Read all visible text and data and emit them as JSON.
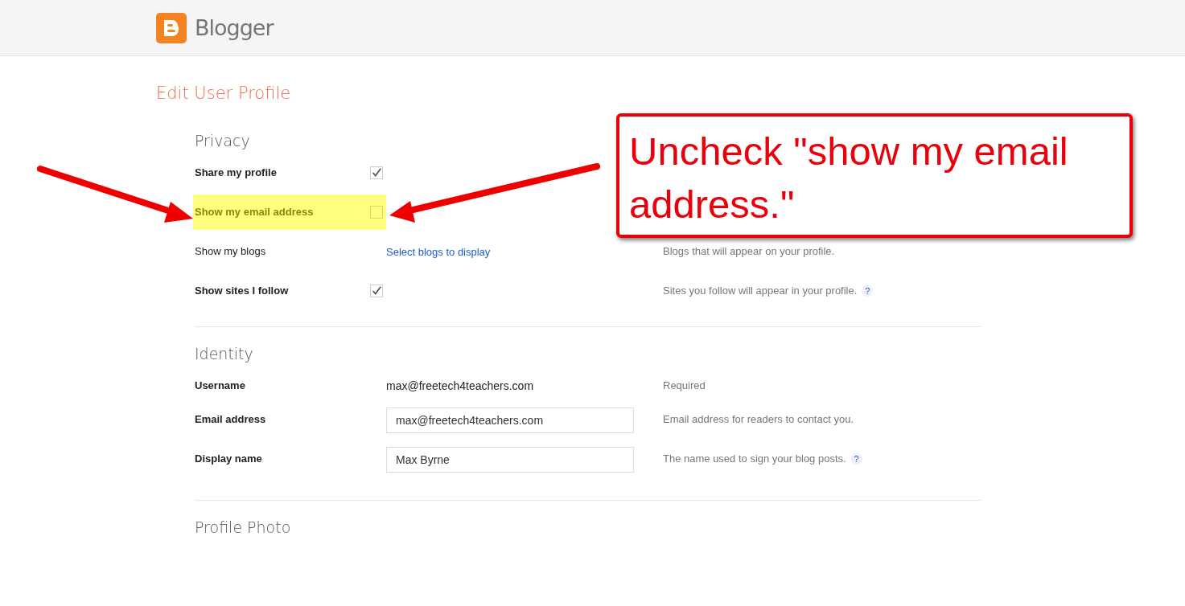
{
  "header": {
    "brand": "Blogger"
  },
  "page_title": "Edit User Profile",
  "sections": [
    {
      "title": "Privacy",
      "rows": [
        {
          "kind": "checkbox",
          "label": "Share my profile",
          "checked": true,
          "highlighted": false
        },
        {
          "kind": "checkbox",
          "label": "Show my email address",
          "checked": false,
          "highlighted": true
        },
        {
          "kind": "link",
          "label": "Show my blogs",
          "link": "Select blogs to display",
          "hint": "Blogs that will appear on your profile.",
          "highlighted": false
        },
        {
          "kind": "checkbox",
          "label": "Show sites I follow",
          "checked": true,
          "hint": "Sites you follow will appear in your profile.",
          "help": "?",
          "highlighted": false
        }
      ]
    },
    {
      "title": "Identity",
      "rows": [
        {
          "kind": "text",
          "label": "Username",
          "value": "max@freetech4teachers.com",
          "hint": "Required",
          "highlighted": false
        },
        {
          "kind": "input",
          "label": "Email address",
          "value": "max@freetech4teachers.com",
          "hint": "Email address for readers to contact you.",
          "highlighted": false
        },
        {
          "kind": "input",
          "label": "Display name",
          "value": "Max Byrne",
          "hint": "The name used to sign your blog posts.",
          "help": "?",
          "highlighted": false
        }
      ]
    },
    {
      "title": "Profile Photo"
    }
  ],
  "callout": {
    "text": "Uncheck \"show my email address.\""
  }
}
